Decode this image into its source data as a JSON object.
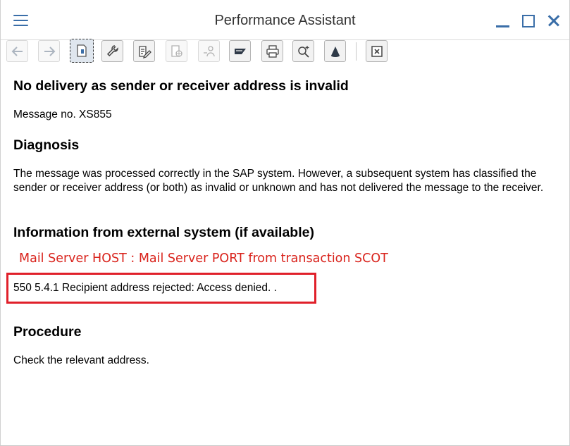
{
  "window": {
    "title": "Performance Assistant"
  },
  "toolbar": {
    "buttons": [
      {
        "name": "back",
        "icon": "arrow-left-icon"
      },
      {
        "name": "forward",
        "icon": "arrow-right-icon"
      },
      {
        "name": "technical-info",
        "icon": "document-info-icon"
      },
      {
        "name": "settings",
        "icon": "wrench-icon"
      },
      {
        "name": "edit",
        "icon": "edit-document-icon"
      },
      {
        "name": "glossary",
        "icon": "document-globe-icon"
      },
      {
        "name": "user",
        "icon": "user-key-icon"
      },
      {
        "name": "sap",
        "icon": "sap-logo-icon"
      },
      {
        "name": "print",
        "icon": "printer-icon"
      },
      {
        "name": "find",
        "icon": "magnifier-plus-icon"
      },
      {
        "name": "navigate",
        "icon": "cone-icon"
      },
      {
        "name": "close-help",
        "icon": "close-box-icon"
      }
    ]
  },
  "doc": {
    "heading": "No delivery as sender or receiver address is invalid",
    "message_no": "Message no. XS855",
    "diagnosis_heading": "Diagnosis",
    "diagnosis_text": "The message was processed correctly in the SAP system. However, a subsequent system has classified the sender or receiver address (or both) as invalid or unknown and has not delivered the message to the receiver.",
    "external_heading": "Information from external system (if available)",
    "annotation": "Mail Server HOST : Mail Server PORT from transaction SCOT",
    "external_text": "550 5.4.1 Recipient address rejected: Access denied. .",
    "procedure_heading": "Procedure",
    "procedure_text": "Check the relevant address."
  },
  "colors": {
    "accent": "#3a6ea8",
    "annotation_red": "#d9231c",
    "highlight_border": "#e0202a"
  }
}
